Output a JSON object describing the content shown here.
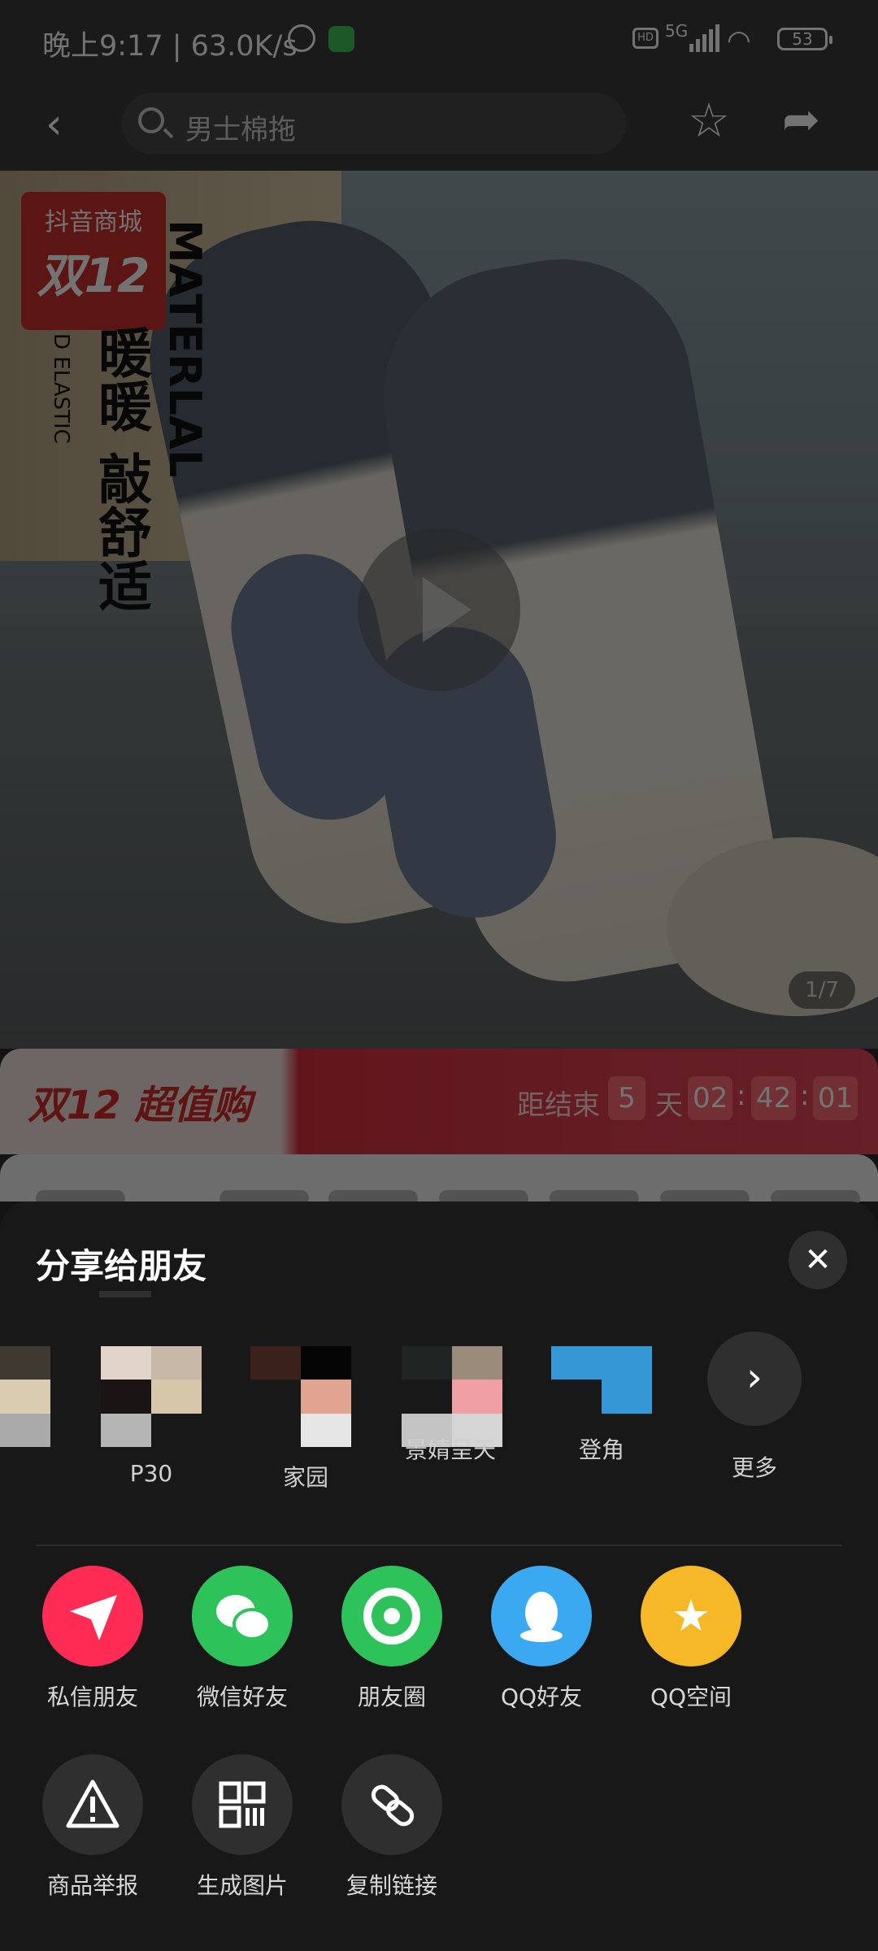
{
  "status_bar": {
    "time": "晚上9:17 | 63.0K/s",
    "network": "5G",
    "hd": "HD",
    "battery": "53"
  },
  "nav": {
    "back_icon": "chevron-left",
    "search_placeholder": "男士棉拖",
    "favorite_icon": "star-outline",
    "share_icon": "share-arrow"
  },
  "hero": {
    "badge_top": "抖音商城",
    "badge_bottom": "双12",
    "vertical_en": "MATERLAL",
    "vertical_cn": "暖暖 敲舒适",
    "vertical_small": "D ELASTIC",
    "image_counter": "1/7"
  },
  "promo": {
    "title": "双12 超值购",
    "ends_label": "距结束",
    "days": "5",
    "day_unit": "天",
    "hours": "02",
    "minutes": "42",
    "seconds": "01"
  },
  "share_sheet": {
    "title": "分享给朋友",
    "friends": [
      {
        "name": ""
      },
      {
        "name": "P30"
      },
      {
        "name": "家园"
      },
      {
        "name": "景婧呈天"
      },
      {
        "name": "登角"
      }
    ],
    "more_label": "更多",
    "share_options": [
      {
        "label": "私信朋友",
        "icon": "send-icon",
        "color": "#fe2c55"
      },
      {
        "label": "微信好友",
        "icon": "wechat-icon",
        "color": "#2ec35a"
      },
      {
        "label": "朋友圈",
        "icon": "moments-icon",
        "color": "#2ec35a"
      },
      {
        "label": "QQ好友",
        "icon": "qq-icon",
        "color": "#3aa9f2"
      },
      {
        "label": "QQ空间",
        "icon": "qzone-icon",
        "color": "#f6b826"
      }
    ],
    "tool_options": [
      {
        "label": "商品举报",
        "icon": "warning-icon"
      },
      {
        "label": "生成图片",
        "icon": "grid-icon"
      },
      {
        "label": "复制链接",
        "icon": "link-icon"
      }
    ]
  }
}
